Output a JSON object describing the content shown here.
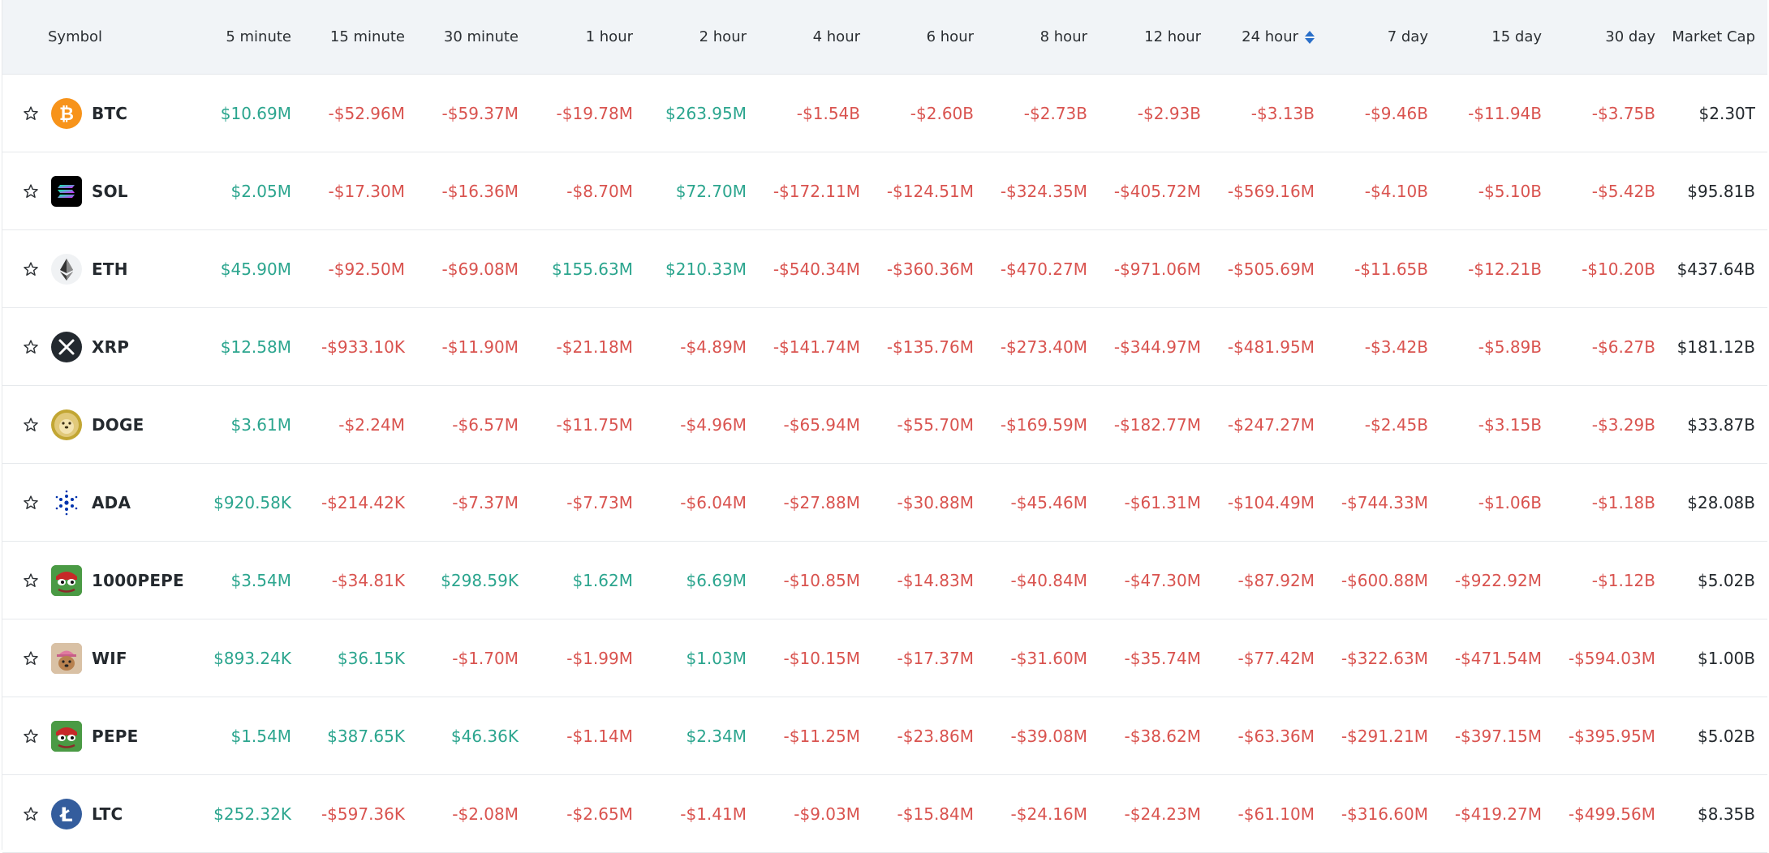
{
  "header": {
    "symbol": "Symbol",
    "columns": [
      "5 minute",
      "15 minute",
      "30 minute",
      "1 hour",
      "2 hour",
      "4 hour",
      "6 hour",
      "8 hour",
      "12 hour",
      "24 hour",
      "7 day",
      "15 day",
      "30 day",
      "Market Cap"
    ],
    "sorted_column": "24 hour"
  },
  "colors": {
    "positive": "#2ba58e",
    "negative": "#d9534f",
    "header_bg": "#f1f4f7",
    "sort_accent": "#2a6fc9"
  },
  "rows": [
    {
      "symbol": "BTC",
      "icon": "bitcoin-icon",
      "values": [
        "$10.69M",
        "-$52.96M",
        "-$59.37M",
        "-$19.78M",
        "$263.95M",
        "-$1.54B",
        "-$2.60B",
        "-$2.73B",
        "-$2.93B",
        "-$3.13B",
        "-$9.46B",
        "-$11.94B",
        "-$3.75B",
        "$2.30T"
      ]
    },
    {
      "symbol": "SOL",
      "icon": "solana-icon",
      "values": [
        "$2.05M",
        "-$17.30M",
        "-$16.36M",
        "-$8.70M",
        "$72.70M",
        "-$172.11M",
        "-$124.51M",
        "-$324.35M",
        "-$405.72M",
        "-$569.16M",
        "-$4.10B",
        "-$5.10B",
        "-$5.42B",
        "$95.81B"
      ]
    },
    {
      "symbol": "ETH",
      "icon": "ethereum-icon",
      "values": [
        "$45.90M",
        "-$92.50M",
        "-$69.08M",
        "$155.63M",
        "$210.33M",
        "-$540.34M",
        "-$360.36M",
        "-$470.27M",
        "-$971.06M",
        "-$505.69M",
        "-$11.65B",
        "-$12.21B",
        "-$10.20B",
        "$437.64B"
      ]
    },
    {
      "symbol": "XRP",
      "icon": "xrp-icon",
      "values": [
        "$12.58M",
        "-$933.10K",
        "-$11.90M",
        "-$21.18M",
        "-$4.89M",
        "-$141.74M",
        "-$135.76M",
        "-$273.40M",
        "-$344.97M",
        "-$481.95M",
        "-$3.42B",
        "-$5.89B",
        "-$6.27B",
        "$181.12B"
      ]
    },
    {
      "symbol": "DOGE",
      "icon": "dogecoin-icon",
      "values": [
        "$3.61M",
        "-$2.24M",
        "-$6.57M",
        "-$11.75M",
        "-$4.96M",
        "-$65.94M",
        "-$55.70M",
        "-$169.59M",
        "-$182.77M",
        "-$247.27M",
        "-$2.45B",
        "-$3.15B",
        "-$3.29B",
        "$33.87B"
      ]
    },
    {
      "symbol": "ADA",
      "icon": "cardano-icon",
      "values": [
        "$920.58K",
        "-$214.42K",
        "-$7.37M",
        "-$7.73M",
        "-$6.04M",
        "-$27.88M",
        "-$30.88M",
        "-$45.46M",
        "-$61.31M",
        "-$104.49M",
        "-$744.33M",
        "-$1.06B",
        "-$1.18B",
        "$28.08B"
      ]
    },
    {
      "symbol": "1000PEPE",
      "icon": "pepe-frog-icon",
      "values": [
        "$3.54M",
        "-$34.81K",
        "$298.59K",
        "$1.62M",
        "$6.69M",
        "-$10.85M",
        "-$14.83M",
        "-$40.84M",
        "-$47.30M",
        "-$87.92M",
        "-$600.88M",
        "-$922.92M",
        "-$1.12B",
        "$5.02B"
      ]
    },
    {
      "symbol": "WIF",
      "icon": "dogwifhat-icon",
      "values": [
        "$893.24K",
        "$36.15K",
        "-$1.70M",
        "-$1.99M",
        "$1.03M",
        "-$10.15M",
        "-$17.37M",
        "-$31.60M",
        "-$35.74M",
        "-$77.42M",
        "-$322.63M",
        "-$471.54M",
        "-$594.03M",
        "$1.00B"
      ]
    },
    {
      "symbol": "PEPE",
      "icon": "pepe-frog-icon",
      "values": [
        "$1.54M",
        "$387.65K",
        "$46.36K",
        "-$1.14M",
        "$2.34M",
        "-$11.25M",
        "-$23.86M",
        "-$39.08M",
        "-$38.62M",
        "-$63.36M",
        "-$291.21M",
        "-$397.15M",
        "-$395.95M",
        "$5.02B"
      ]
    },
    {
      "symbol": "LTC",
      "icon": "litecoin-icon",
      "values": [
        "$252.32K",
        "-$597.36K",
        "-$2.08M",
        "-$2.65M",
        "-$1.41M",
        "-$9.03M",
        "-$15.84M",
        "-$24.16M",
        "-$24.23M",
        "-$61.10M",
        "-$316.60M",
        "-$419.27M",
        "-$499.56M",
        "$8.35B"
      ]
    }
  ]
}
